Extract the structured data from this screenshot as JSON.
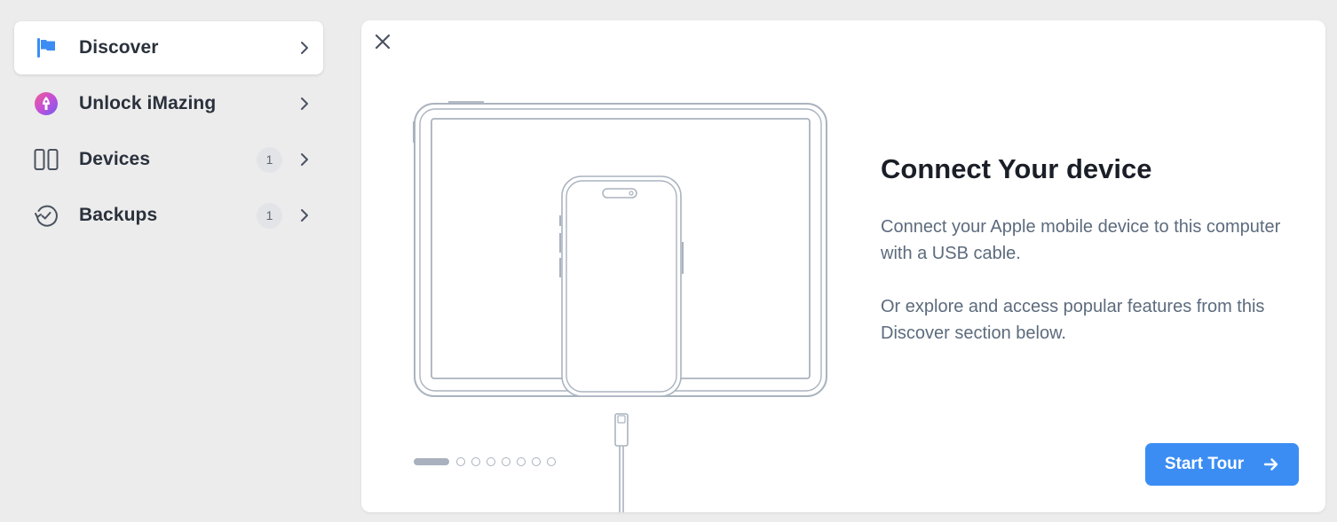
{
  "sidebar": {
    "items": [
      {
        "label": "Discover",
        "icon": "flag-icon",
        "active": true,
        "badge": ""
      },
      {
        "label": "Unlock iMazing",
        "icon": "unlock-icon",
        "active": false,
        "badge": ""
      },
      {
        "label": "Devices",
        "icon": "devices-icon",
        "active": false,
        "badge": "1"
      },
      {
        "label": "Backups",
        "icon": "backup-icon",
        "active": false,
        "badge": "1"
      }
    ]
  },
  "panel": {
    "close_icon": "close-icon",
    "title": "Connect Your device",
    "paragraph1": "Connect your Apple mobile device to this computer with a USB cable.",
    "paragraph2": "Or explore and access popular features from this Discover section below.",
    "pager": {
      "current": 1,
      "total": 8
    },
    "start_label": "Start Tour",
    "start_icon": "arrow-right-icon"
  },
  "colors": {
    "accent": "#3b8df3",
    "background": "#ececec",
    "card": "#ffffff",
    "text_muted": "#5c6b7d"
  }
}
